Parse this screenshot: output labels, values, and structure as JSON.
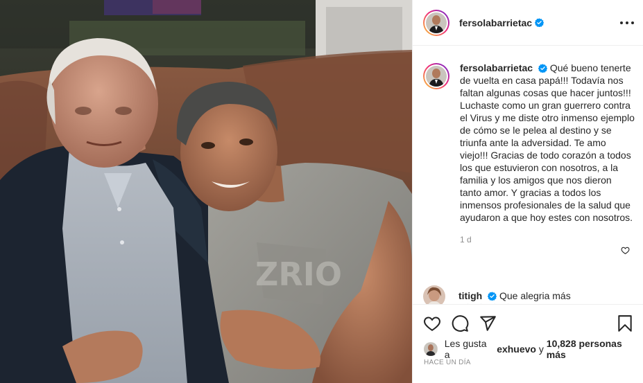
{
  "post": {
    "username": "fersolabarrietac",
    "caption_text": "Qué bueno tenerte de vuelta en casa papá!!! Todavía nos faltan algunas cosas que hacer juntos!!! Luchaste como un gran guerrero contra el Virus y me diste otro inmenso ejemplo de cómo se le pelea al destino y se triunfa ante la adversidad. Te amo viejo!!! Gracias de todo corazón a todos los que estuvieron con nosotros, a la familia y los amigos que nos dieron tanto amor. Y gracias a todos los inmensos profesionales de la salud que ayudaron a que hoy estes con nosotros.",
    "caption_time": "1 d",
    "date": "Hace un día"
  },
  "comment": {
    "username": "titigh",
    "text": "Que alegria más",
    "emojis": "👏👏👏👏❤❤❤❤"
  },
  "likes": {
    "prefix": "Les gusta a",
    "first_user": "exhuevo",
    "joiner": "y",
    "count_text": "10,828 personas más"
  },
  "icons": {
    "more": "more-options-icon",
    "verified": "verified-badge-icon",
    "like": "heart-icon",
    "comment": "comment-bubble-icon",
    "share": "paper-plane-icon",
    "save": "bookmark-icon"
  },
  "colors": {
    "verified_blue": "#0095f6",
    "text": "#262626",
    "muted": "#8e8e8e",
    "divider": "#efefef"
  }
}
